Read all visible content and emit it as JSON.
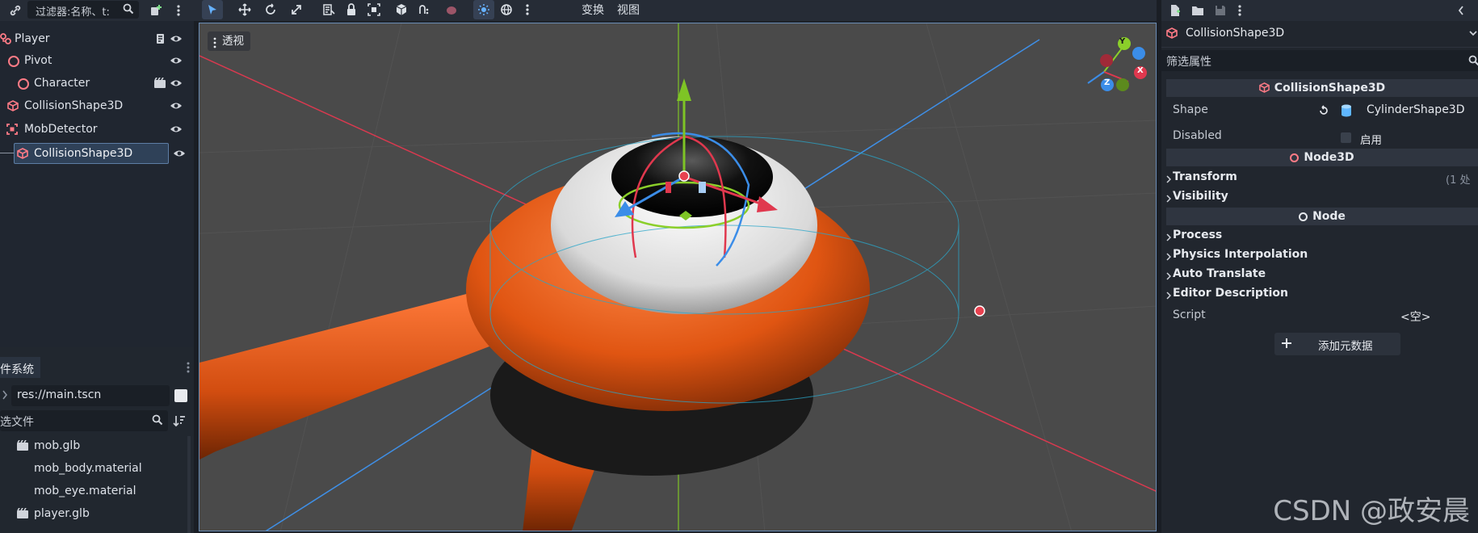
{
  "scene_dock": {
    "filter_placeholder": "过滤器:名称、t:",
    "tree": [
      {
        "label": "Player",
        "icon": "node3d-icon",
        "has_script": true
      },
      {
        "label": "Pivot",
        "icon": "node3d-ring-icon"
      },
      {
        "label": "Character",
        "icon": "node3d-ring-icon",
        "has_scene": true
      },
      {
        "label": "CollisionShape3D",
        "icon": "collision-shape-icon"
      },
      {
        "label": "MobDetector",
        "icon": "area3d-icon"
      },
      {
        "label": "CollisionShape3D",
        "icon": "collision-shape-icon",
        "selected": true
      }
    ]
  },
  "filesystem_dock": {
    "tab_label": "件系统",
    "path": "res://main.tscn",
    "filter_placeholder": "选文件",
    "items": [
      {
        "label": "mob.glb",
        "icon": "scene-icon"
      },
      {
        "label": "mob_body.material",
        "icon": "material-icon"
      },
      {
        "label": "mob_eye.material",
        "icon": "material-icon"
      },
      {
        "label": "player.glb",
        "icon": "scene-icon"
      }
    ]
  },
  "toolbar": {
    "transform_menu": "变换",
    "view_menu": "视图"
  },
  "viewport": {
    "perspective_label": "透视",
    "gizmo_axes": [
      "Y",
      "X",
      "Z"
    ]
  },
  "inspector": {
    "node_name": "CollisionShape3D",
    "filter_placeholder": "筛选属性",
    "section_collision": "CollisionShape3D",
    "shape_label": "Shape",
    "shape_value": "CylinderShape3D",
    "disabled_label": "Disabled",
    "disabled_value": "启用",
    "section_node3d": "Node3D",
    "transform_label": "Transform",
    "transform_badge": "(1 处",
    "visibility_label": "Visibility",
    "section_node": "Node",
    "process_label": "Process",
    "physics_interp_label": "Physics Interpolation",
    "auto_translate_label": "Auto Translate",
    "editor_desc_label": "Editor Description",
    "script_label": "Script",
    "script_value": "<空>",
    "add_metadata_label": "添加元数据"
  },
  "watermark": "CSDN @政安晨",
  "colors": {
    "accent_blue": "#66b2ff",
    "node_red": "#ff7b86",
    "viewport_bg": "#4a4a4a",
    "selection_bg": "#2f4158"
  }
}
